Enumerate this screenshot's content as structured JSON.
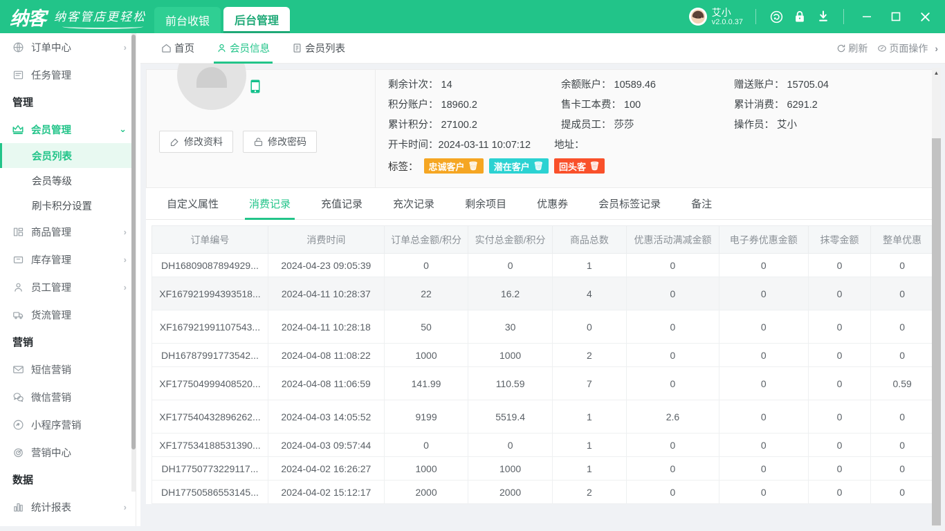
{
  "titlebar": {
    "logo_main": "纳客",
    "logo_slogan": "纳客管店更轻松",
    "nav": [
      {
        "label": "前台收银",
        "active": false
      },
      {
        "label": "后台管理",
        "active": true
      }
    ],
    "user_name": "艾小",
    "version": "v2.0.0.37",
    "icons": [
      "headset-icon",
      "lock-icon",
      "download-icon"
    ],
    "window_controls": [
      "minimize-icon",
      "maximize-icon",
      "close-icon"
    ],
    "accent": "#22c489"
  },
  "sidebar": {
    "items": [
      {
        "type": "item",
        "icon": "globe-icon",
        "label": "订单中心",
        "arrow": "›"
      },
      {
        "type": "item",
        "icon": "task-icon",
        "label": "任务管理",
        "arrow": ""
      },
      {
        "type": "group",
        "label": "管理"
      },
      {
        "type": "item",
        "icon": "crown-icon",
        "label": "会员管理",
        "arrow": "⌄",
        "expanded": true
      },
      {
        "type": "sub",
        "label": "会员列表",
        "active": true
      },
      {
        "type": "sub",
        "label": "会员等级",
        "active": false
      },
      {
        "type": "sub",
        "label": "刷卡积分设置",
        "active": false
      },
      {
        "type": "item",
        "icon": "goods-icon",
        "label": "商品管理",
        "arrow": "›"
      },
      {
        "type": "item",
        "icon": "inventory-icon",
        "label": "库存管理",
        "arrow": "›"
      },
      {
        "type": "item",
        "icon": "staff-icon",
        "label": "员工管理",
        "arrow": "›"
      },
      {
        "type": "item",
        "icon": "truck-icon",
        "label": "货流管理",
        "arrow": ""
      },
      {
        "type": "group",
        "label": "营销"
      },
      {
        "type": "item",
        "icon": "envelope-icon",
        "label": "短信营销",
        "arrow": ""
      },
      {
        "type": "item",
        "icon": "wechat-icon",
        "label": "微信营销",
        "arrow": ""
      },
      {
        "type": "item",
        "icon": "miniprogram-icon",
        "label": "小程序营销",
        "arrow": ""
      },
      {
        "type": "item",
        "icon": "target-icon",
        "label": "营销中心",
        "arrow": ""
      },
      {
        "type": "group",
        "label": "数据"
      },
      {
        "type": "item",
        "icon": "chart-icon",
        "label": "统计报表",
        "arrow": "›"
      }
    ]
  },
  "page_tabs": {
    "tabs": [
      {
        "label": "首页",
        "icon": "home-icon",
        "active": false
      },
      {
        "label": "会员信息",
        "icon": "user-icon",
        "active": true
      },
      {
        "label": "会员列表",
        "icon": "list-icon",
        "active": false
      }
    ],
    "right_actions": [
      {
        "label": "刷新",
        "icon": "refresh-icon"
      },
      {
        "label": "页面操作",
        "icon": "pageops-icon"
      }
    ],
    "right_chevron": "›"
  },
  "member": {
    "buttons": [
      {
        "label": "修改资料",
        "icon": "edit-icon"
      },
      {
        "label": "修改密码",
        "icon": "unlock-icon"
      }
    ],
    "phone_icon": "mobile-icon",
    "fields": [
      {
        "label": "剩余计次：",
        "value": "14"
      },
      {
        "label": "余额账户：",
        "value": "10589.46"
      },
      {
        "label": "赠送账户：",
        "value": "15705.04"
      },
      {
        "label": "积分账户：",
        "value": "18960.2"
      },
      {
        "label": "售卡工本费：",
        "value": "100"
      },
      {
        "label": "累计消费：",
        "value": "6291.2"
      },
      {
        "label": "累计积分：",
        "value": "27100.2"
      },
      {
        "label": "提成员工：",
        "value": "莎莎"
      },
      {
        "label": "操作员：",
        "value": "艾小"
      }
    ],
    "wide_row": [
      {
        "label": "开卡时间：",
        "value": "2024-03-11 10:07:12"
      },
      {
        "label": "地址：",
        "value": ""
      }
    ],
    "tags_label": "标签：",
    "tags": [
      {
        "label": "忠诚客户",
        "color": "#f5a623",
        "trash": "🗑"
      },
      {
        "label": "潜在客户",
        "color": "#2bd2d2",
        "trash": "🗑"
      },
      {
        "label": "回头客",
        "color": "#f9502a",
        "trash": "🗑"
      }
    ]
  },
  "inner_tabs": [
    {
      "label": "自定义属性",
      "active": false
    },
    {
      "label": "消费记录",
      "active": true
    },
    {
      "label": "充值记录",
      "active": false
    },
    {
      "label": "充次记录",
      "active": false
    },
    {
      "label": "剩余项目",
      "active": false
    },
    {
      "label": "优惠券",
      "active": false
    },
    {
      "label": "会员标签记录",
      "active": false
    },
    {
      "label": "备注",
      "active": false
    }
  ],
  "table": {
    "columns": [
      "订单编号",
      "消费时间",
      "订单总金额/积分",
      "实付总金额/积分",
      "商品总数",
      "优惠活动满减金额",
      "电子券优惠金额",
      "抹零金额",
      "整单优惠"
    ],
    "rows": [
      {
        "cells": [
          "DH16809087894929...",
          "2024-04-23 09:05:39",
          "0",
          "0",
          "1",
          "0",
          "0",
          "0",
          "0"
        ],
        "tall": false,
        "alt": false
      },
      {
        "cells": [
          "XF167921994393518...",
          "2024-04-11 10:28:37",
          "22",
          "16.2",
          "4",
          "0",
          "0",
          "0",
          "0"
        ],
        "tall": true,
        "alt": true
      },
      {
        "cells": [
          "XF167921991107543...",
          "2024-04-11 10:28:18",
          "50",
          "30",
          "0",
          "0",
          "0",
          "0",
          "0"
        ],
        "tall": true,
        "alt": false
      },
      {
        "cells": [
          "DH16787991773542...",
          "2024-04-08 11:08:22",
          "1000",
          "1000",
          "2",
          "0",
          "0",
          "0",
          "0"
        ],
        "tall": false,
        "alt": false
      },
      {
        "cells": [
          "XF177504999408520...",
          "2024-04-08 11:06:59",
          "141.99",
          "110.59",
          "7",
          "0",
          "0",
          "0",
          "0.59"
        ],
        "tall": true,
        "alt": false
      },
      {
        "cells": [
          "XF177540432896262...",
          "2024-04-03 14:05:52",
          "9199",
          "5519.4",
          "1",
          "2.6",
          "0",
          "0",
          "0"
        ],
        "tall": true,
        "alt": false
      },
      {
        "cells": [
          "XF177534188531390...",
          "2024-04-03 09:57:44",
          "0",
          "0",
          "1",
          "0",
          "0",
          "0",
          "0"
        ],
        "tall": false,
        "alt": false
      },
      {
        "cells": [
          "DH17750773229117...",
          "2024-04-02 16:26:27",
          "1000",
          "1000",
          "1",
          "0",
          "0",
          "0",
          "0"
        ],
        "tall": false,
        "alt": false
      },
      {
        "cells": [
          "DH17750586553145...",
          "2024-04-02 15:12:17",
          "2000",
          "2000",
          "2",
          "0",
          "0",
          "0",
          "0"
        ],
        "tall": false,
        "alt": false
      }
    ]
  }
}
